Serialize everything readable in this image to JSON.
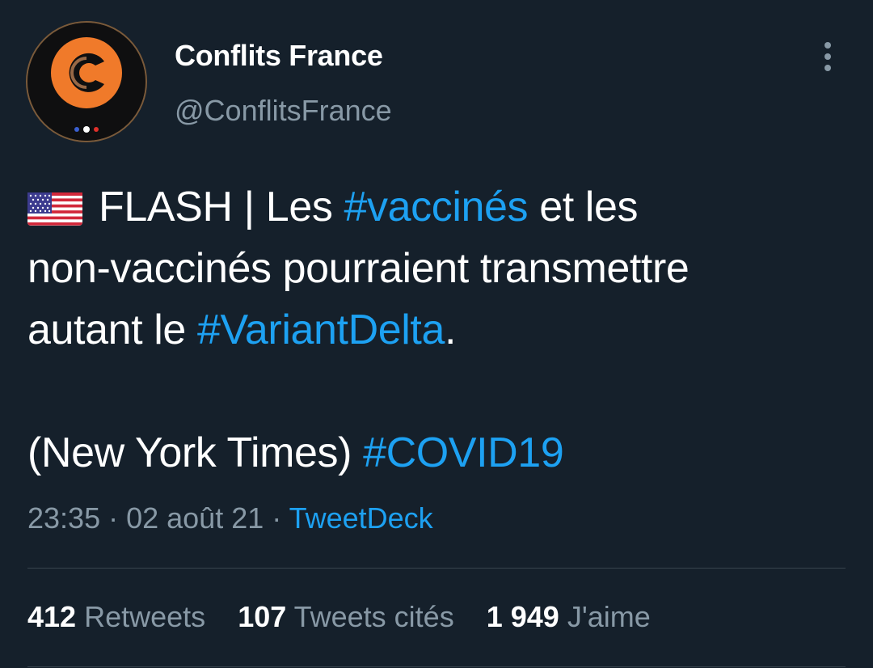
{
  "author": {
    "display_name": "Conflits France",
    "handle": "@ConflitsFrance",
    "avatar_icon": "conflits-france-logo",
    "avatar_colors": {
      "ring": "#f07a2a",
      "letter": "#f2a36b",
      "background": "#0f0f10"
    }
  },
  "menu_icon": "vertical-ellipsis-icon",
  "tweet": {
    "flag_icon": "us-flag-icon",
    "line1": {
      "text1": "FLASH | Les ",
      "hashtag1": "#vaccinés",
      "text2": " et les"
    },
    "line2": {
      "text": "non-vaccinés pourraient transmettre"
    },
    "line3": {
      "text1": "autant le ",
      "hashtag2": "#VariantDelta",
      "text2": "."
    },
    "line5": {
      "text1": "(New York Times) ",
      "hashtag3": "#COVID19"
    }
  },
  "meta": {
    "time": "23:35",
    "separator1": " · ",
    "date": "02 août 21",
    "separator2": " · ",
    "source": "TweetDeck"
  },
  "stats": {
    "retweets": {
      "count": "412",
      "label": "Retweets"
    },
    "quotes": {
      "count": "107",
      "label": "Tweets cités"
    },
    "likes": {
      "count": "1 949",
      "label": "J'aime"
    }
  },
  "colors": {
    "background": "#15202b",
    "link": "#1da1f2",
    "secondary_text": "#8899a6",
    "divider": "#38444d"
  }
}
